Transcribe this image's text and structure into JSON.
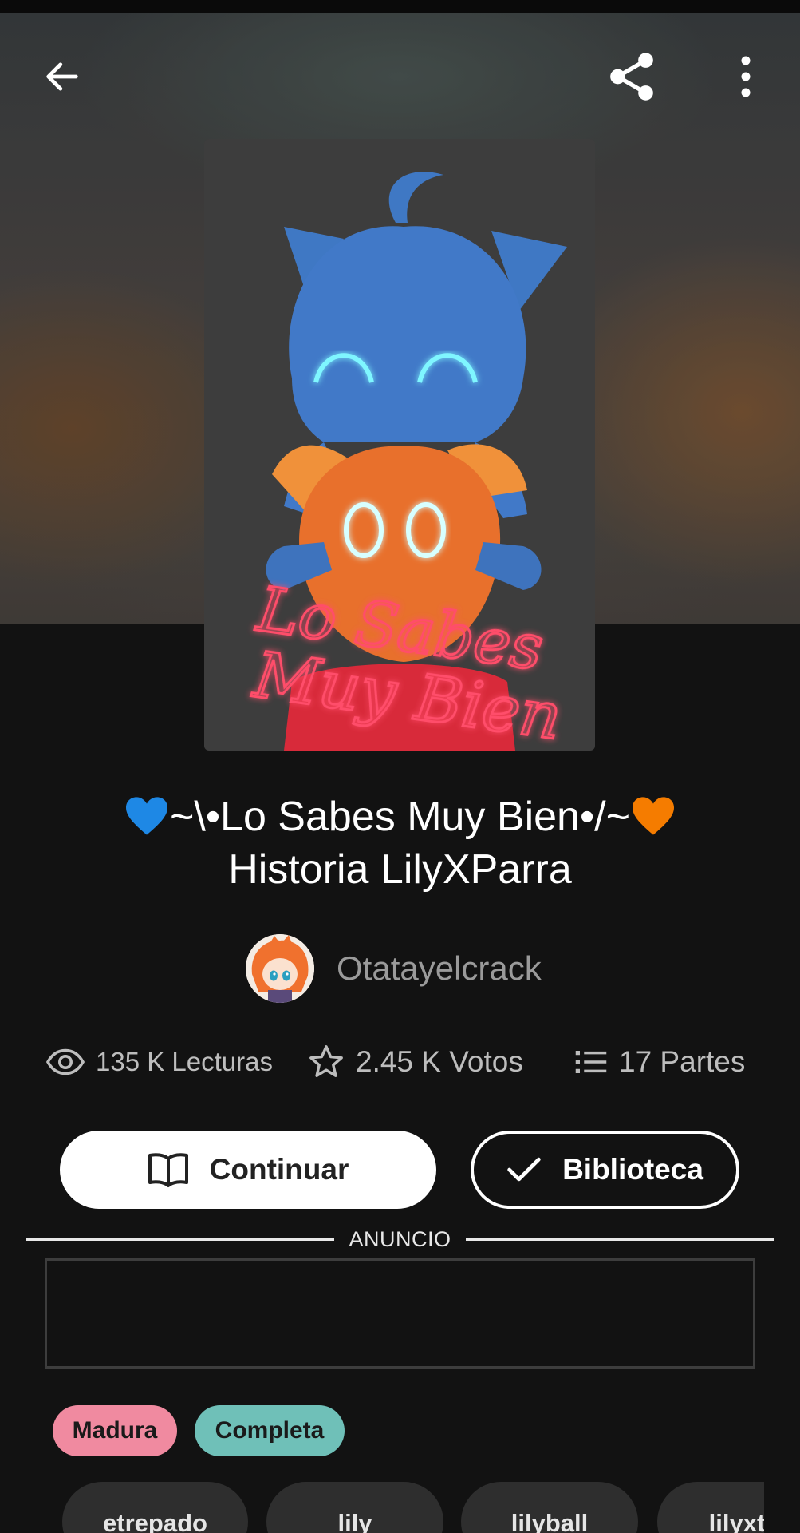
{
  "story": {
    "title": "~\\•Lo Sabes Muy Bien•/~",
    "subtitle": "Historia LilyXParra",
    "cover_text_line1": "Lo Sabes",
    "cover_text_line2": "Muy Bien",
    "author": "Otatayelcrack"
  },
  "stats": {
    "reads": "135 K Lecturas",
    "votes": "2.45 K Votos",
    "parts": "17 Partes"
  },
  "actions": {
    "continue_label": "Continuar",
    "library_label": "Biblioteca"
  },
  "ad": {
    "label": "ANUNCIO"
  },
  "tags": {
    "mature": "Madura",
    "complete": "Completa"
  },
  "chips": [
    "etrepado",
    "lily",
    "lilyball",
    "lilyxt"
  ],
  "icons": {
    "back": "arrow-left-icon",
    "share": "share-icon",
    "more": "more-vertical-icon",
    "reads": "eye-icon",
    "votes": "star-icon",
    "parts": "list-icon",
    "continue": "book-icon",
    "library": "check-icon"
  },
  "colors": {
    "background": "#121212",
    "tag_mature": "#f08aa0",
    "tag_complete": "#6fc0b8",
    "heart_blue": "#1e88e5",
    "heart_orange": "#f57c00"
  }
}
